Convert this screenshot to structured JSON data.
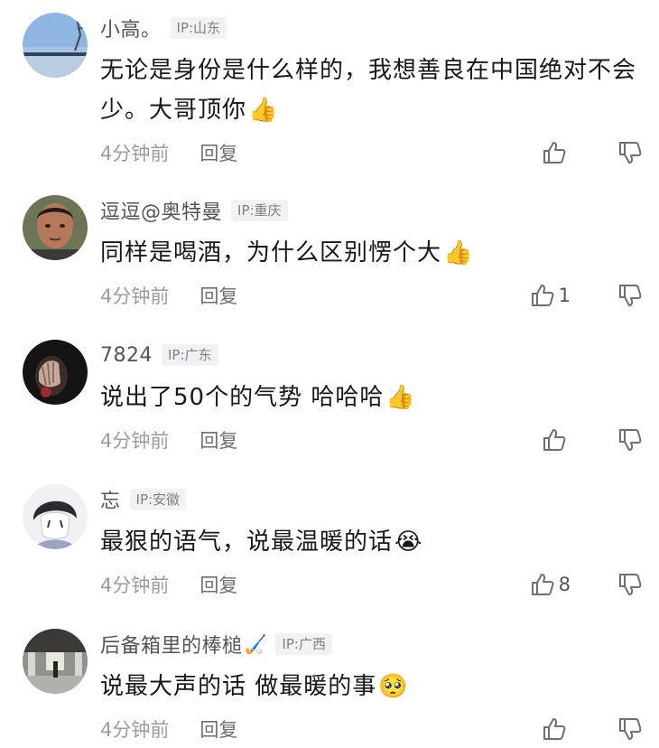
{
  "comments": [
    {
      "name": "小高。",
      "name_emoji": "",
      "ip": "IP:山东",
      "text": "无论是身份是什么样的，我想善良在中国绝对不会少。大哥顶你",
      "emoji": "👍",
      "time": "4分钟前",
      "reply": "回复",
      "likes": "",
      "avatar": "lake-scene-avatar"
    },
    {
      "name": "逗逗@奥特曼",
      "name_emoji": "",
      "ip": "IP:重庆",
      "text": "同样是喝酒，为什么区别愣个大",
      "emoji": "👍",
      "time": "4分钟前",
      "reply": "回复",
      "likes": "1",
      "avatar": "man-face-avatar"
    },
    {
      "name": "7824",
      "name_emoji": "",
      "ip": "IP:广东",
      "text": "说出了50个的气势 哈哈哈",
      "emoji": "👍",
      "time": "4分钟前",
      "reply": "回复",
      "likes": "",
      "avatar": "dark-hand-avatar"
    },
    {
      "name": "忘",
      "name_emoji": "",
      "ip": "IP:安徽",
      "text": "最狠的语气，说最温暖的话",
      "emoji": "😭",
      "time": "4分钟前",
      "reply": "回复",
      "likes": "8",
      "avatar": "anime-boy-avatar"
    },
    {
      "name": "后备箱里的棒槌",
      "name_emoji": "🏑",
      "ip": "IP:广西",
      "text": "说最大声的话 做最暖的事",
      "emoji": "🥺",
      "time": "4分钟前",
      "reply": "回复",
      "likes": "",
      "avatar": "hallway-avatar"
    }
  ]
}
